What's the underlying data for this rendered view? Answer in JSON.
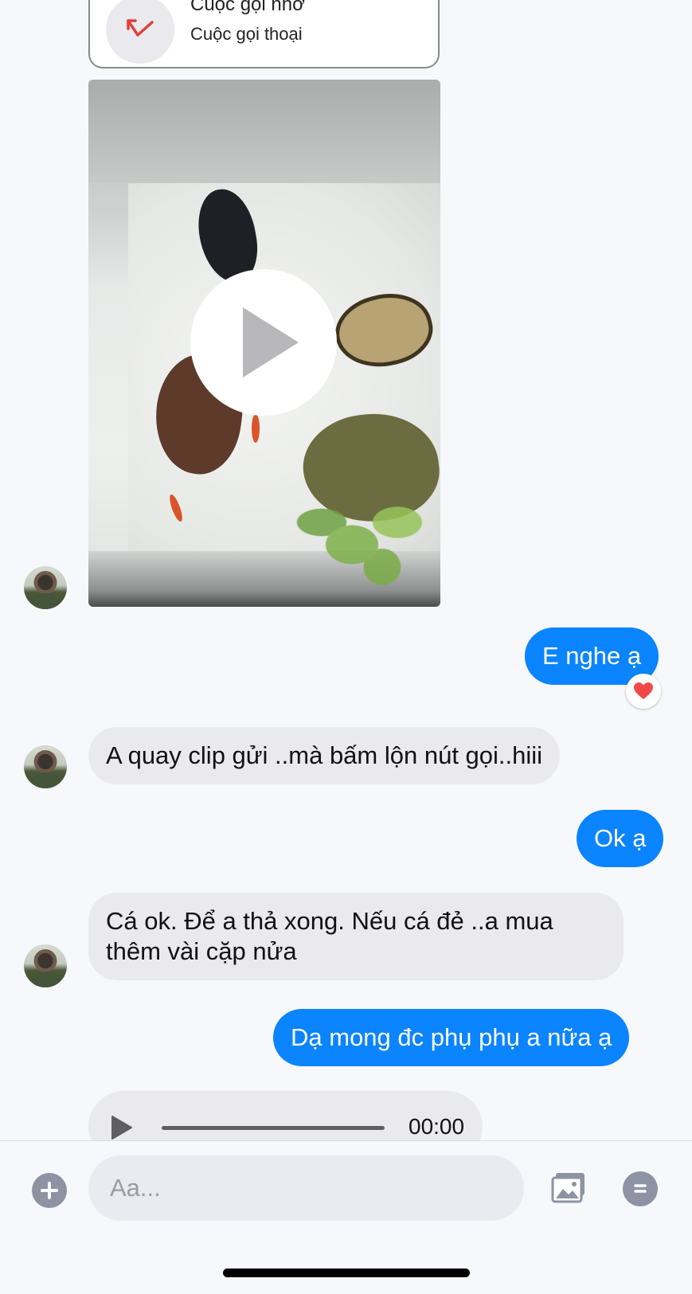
{
  "missed_call": {
    "title": "Cuộc gọi nhỡ",
    "subtitle": "Cuộc gọi thoại",
    "icon": "missed-call-icon",
    "icon_color": "#e0403a"
  },
  "video_message": {
    "play_icon": "play-icon"
  },
  "messages": [
    {
      "direction": "outgoing",
      "text": "E nghe ạ",
      "reaction": "❤️"
    },
    {
      "direction": "incoming",
      "text": "A quay clip gửi ..mà bấm lộn nút gọi..hiii"
    },
    {
      "direction": "outgoing",
      "text": "Ok ạ"
    },
    {
      "direction": "incoming",
      "text": "Cá ok. Để a thả xong. Nếu cá đẻ ..a mua thêm vài cặp nửa"
    },
    {
      "direction": "outgoing",
      "text": "Dạ mong đc phụ phụ a nữa ạ"
    }
  ],
  "audio_message": {
    "time": "00:00",
    "progress": 0
  },
  "composer": {
    "placeholder": "Aa...",
    "value": ""
  },
  "colors": {
    "outgoing_bubble": "#0a84ff",
    "incoming_bubble": "#e9e9ee",
    "background": "#f7f8fb",
    "icon_gray": "#8e93a3"
  }
}
